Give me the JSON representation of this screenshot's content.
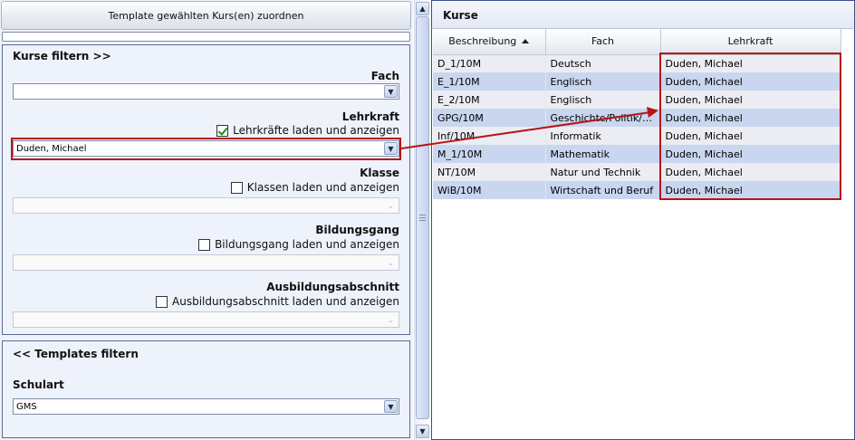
{
  "left": {
    "assign_button": "Template gewählten Kurs(en) zuordnen",
    "filter_courses": {
      "header": "Kurse filtern >>",
      "fach": {
        "label": "Fach",
        "value": ""
      },
      "lehrkraft": {
        "label": "Lehrkraft",
        "checkbox_label": "Lehrkräfte laden und anzeigen",
        "checked": true,
        "value": "Duden, Michael"
      },
      "klasse": {
        "label": "Klasse",
        "checkbox_label": "Klassen laden und anzeigen",
        "checked": false,
        "value": ""
      },
      "bildungsgang": {
        "label": "Bildungsgang",
        "checkbox_label": "Bildungsgang laden und anzeigen",
        "checked": false,
        "value": ""
      },
      "ausbildungsabschnitt": {
        "label": "Ausbildungsabschnitt",
        "checkbox_label": "Ausbildungsabschnitt laden und anzeigen",
        "checked": false,
        "value": ""
      }
    },
    "filter_templates": {
      "header": "<< Templates filtern",
      "schulart": {
        "label": "Schulart",
        "value": "GMS"
      }
    }
  },
  "right": {
    "title": "Kurse",
    "columns": [
      "Beschreibung",
      "Fach",
      "Lehrkraft"
    ],
    "sort_column": "Beschreibung",
    "sort_direction": "ascending",
    "rows": [
      {
        "beschreibung": "D_1/10M",
        "fach": "Deutsch",
        "lehrkraft": "Duden, Michael"
      },
      {
        "beschreibung": "E_1/10M",
        "fach": "Englisch",
        "lehrkraft": "Duden, Michael"
      },
      {
        "beschreibung": "E_2/10M",
        "fach": "Englisch",
        "lehrkraft": "Duden, Michael"
      },
      {
        "beschreibung": "GPG/10M",
        "fach": "Geschichte/Politik/Ge...",
        "lehrkraft": "Duden, Michael"
      },
      {
        "beschreibung": "Inf/10M",
        "fach": "Informatik",
        "lehrkraft": "Duden, Michael"
      },
      {
        "beschreibung": "M_1/10M",
        "fach": "Mathematik",
        "lehrkraft": "Duden, Michael"
      },
      {
        "beschreibung": "NT/10M",
        "fach": "Natur und Technik",
        "lehrkraft": "Duden, Michael"
      },
      {
        "beschreibung": "WiB/10M",
        "fach": "Wirtschaft und Beruf",
        "lehrkraft": "Duden, Michael"
      }
    ]
  },
  "icons": {
    "dropdown": "chevron-down-icon",
    "sort": "sort-ascending-icon",
    "scroll_up": "arrow-up-icon",
    "scroll_down": "arrow-down-icon",
    "annotation": "red-arrow-annotation"
  },
  "colors": {
    "annotation_red": "#b81515",
    "row_alt": "#c9d6ef",
    "row": "#ecedf3",
    "panel_border": "#3d4f8a"
  }
}
